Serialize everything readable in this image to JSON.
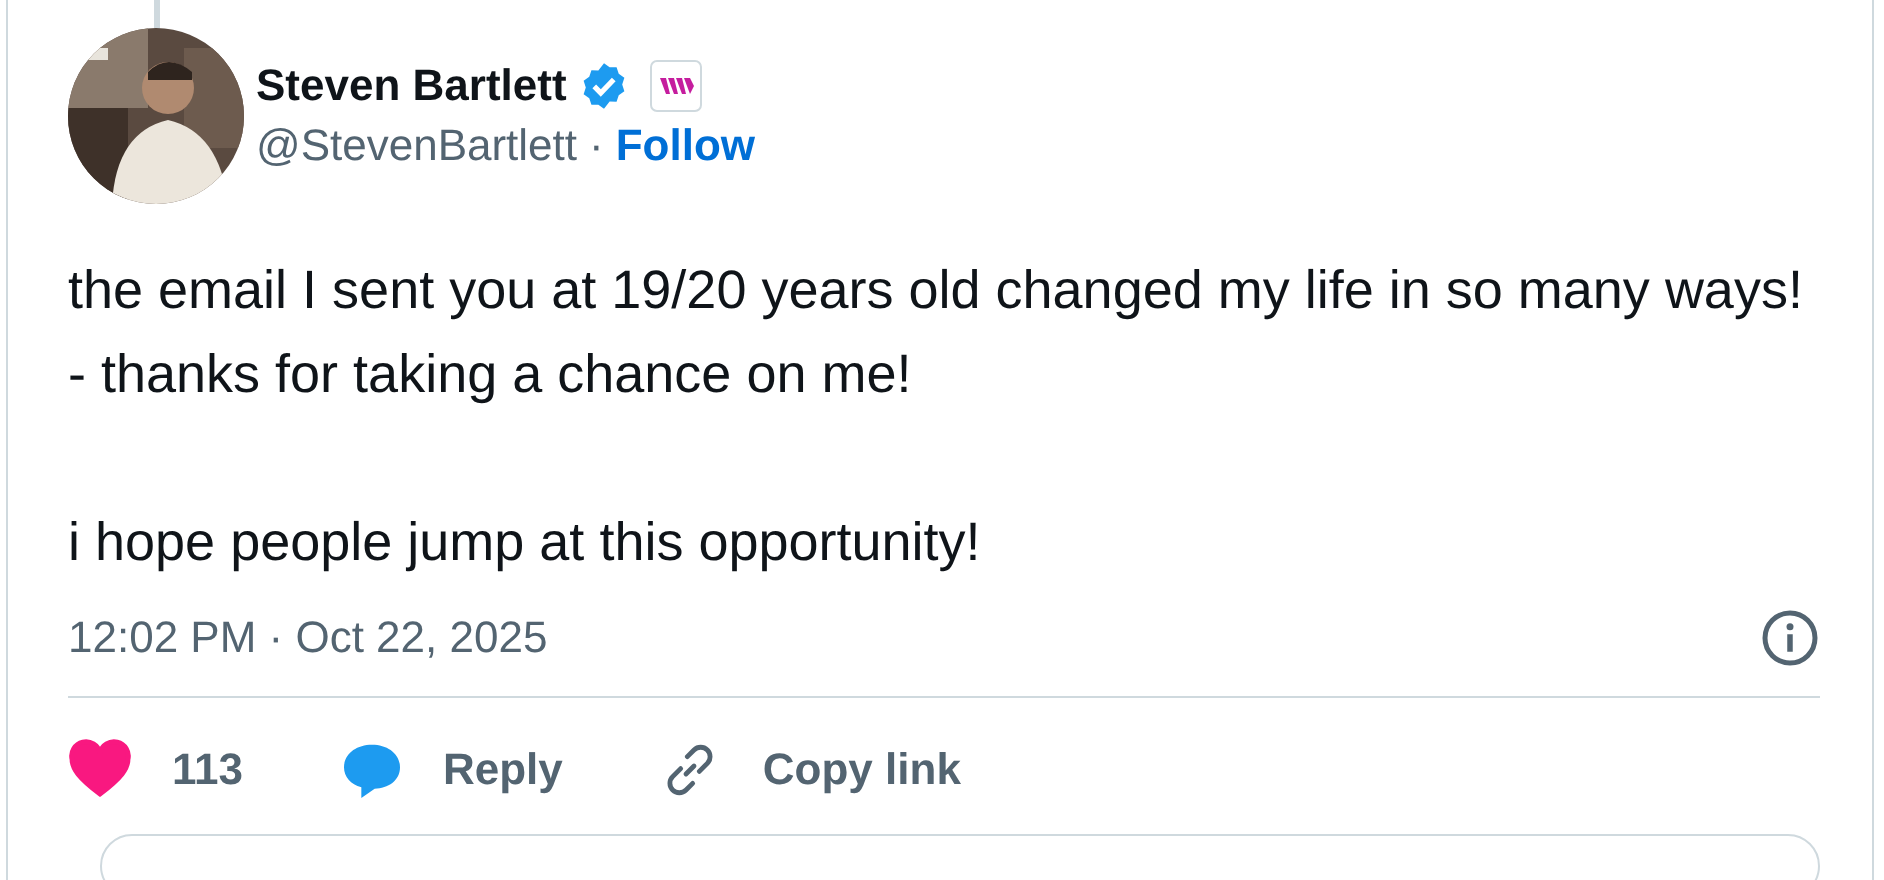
{
  "author": {
    "name": "Steven Bartlett",
    "verified": true,
    "handle": "@StevenBartlett",
    "separator": "·",
    "follow": "Follow"
  },
  "body": [
    "the email I sent you at 19/20 years old changed my life in so many ways! - thanks for taking a chance on me!",
    "i hope people jump at this opportunity!"
  ],
  "timestamp": "12:02 PM · Oct 22, 2025",
  "actions": {
    "like_count": "113",
    "liked": true,
    "reply": "Reply",
    "copy_link": "Copy link"
  }
}
